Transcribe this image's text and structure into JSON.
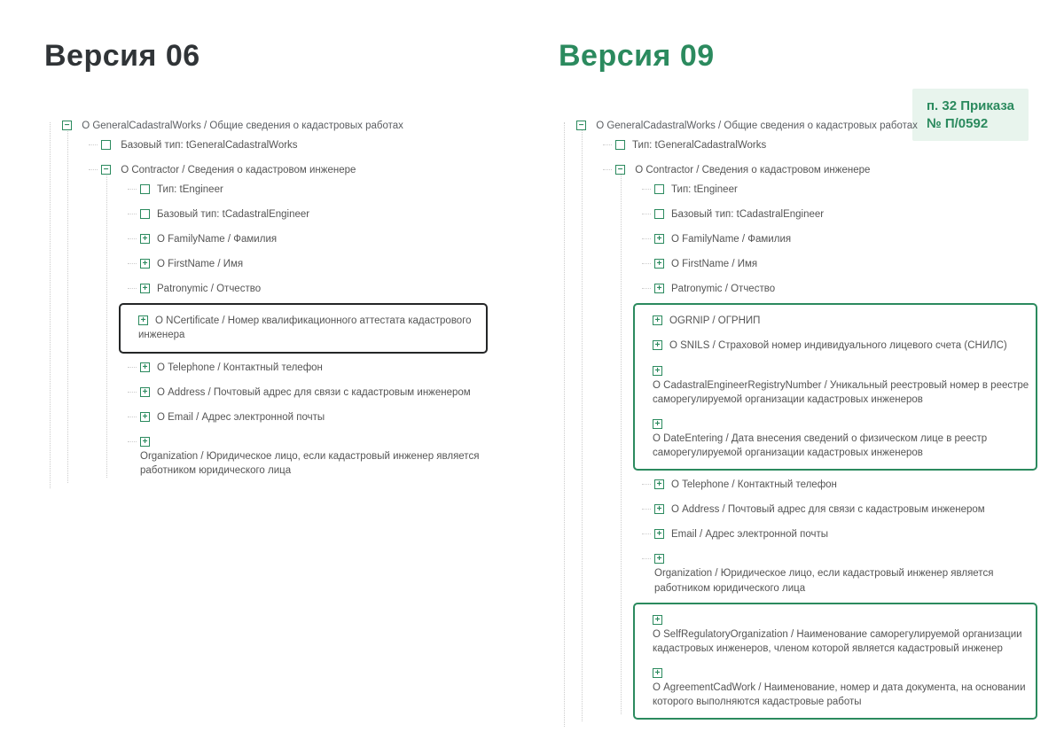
{
  "left": {
    "title": "Версия 06",
    "root": "О GeneralCadastralWorks / Общие сведения о кадастровых работах",
    "n1": "Базовый тип: tGeneralCadastralWorks",
    "n2": "О Contractor / Сведения о кадастровом инженере",
    "c1": "Тип: tEngineer",
    "c2": "Базовый тип: tCadastralEngineer",
    "c3": "О FamilyName / Фамилия",
    "c4": "О FirstName / Имя",
    "c5": "Patronymic / Отчество",
    "c6": "О NCertificate / Номер квалификационного аттестата кадастрового инженера",
    "c7": "О Telephone / Контактный телефон",
    "c8": "О Address / Почтовый адрес для связи с кадастровым инженером",
    "c9": "О Email / Адрес электронной почты",
    "c10": "Organization / Юридическое лицо, если кадастровый инженер является работником юридического лица"
  },
  "right": {
    "title": "Версия 09",
    "badge_l1": "п. 32 Приказа",
    "badge_l2": "№ П/0592",
    "root": "О GeneralCadastralWorks / Общие сведения о кадастровых работах",
    "n1": "Тип: tGeneralCadastralWorks",
    "n2": "О Contractor / Сведения о кадастровом инженере",
    "c1": "Тип: tEngineer",
    "c2": "Базовый тип: tCadastralEngineer",
    "c3": "О FamilyName / Фамилия",
    "c4": "О FirstName / Имя",
    "c5": "Patronymic / Отчество",
    "h1a": "OGRNIP / ОГРНИП",
    "h1b": "О SNILS / Страховой номер индивидуального лицевого счета (СНИЛС)",
    "h1c": "О CadastralEngineerRegistryNumber / Уникальный реестровый номер в реестре саморегулируемой организации кадастровых инженеров",
    "h1d": "О DateEntering / Дата внесения сведений о физическом лице в реестр саморегулируемой организации кадастровых инженеров",
    "c6": "О Telephone / Контактный телефон",
    "c7": "О Address / Почтовый адрес для связи с кадастровым инженером",
    "c8": "Email / Адрес электронной почты",
    "c9": "Organization / Юридическое лицо, если кадастровый инженер является работником юридического лица",
    "h2a": "О SelfRegulatoryOrganization / Наименование саморегулируемой организации кадастровых инженеров, членом которой является кадастровый инженер",
    "h2b": "О AgreementCadWork / Наименование, номер и дата документа, на основании которого выполняются кадастровые работы"
  }
}
